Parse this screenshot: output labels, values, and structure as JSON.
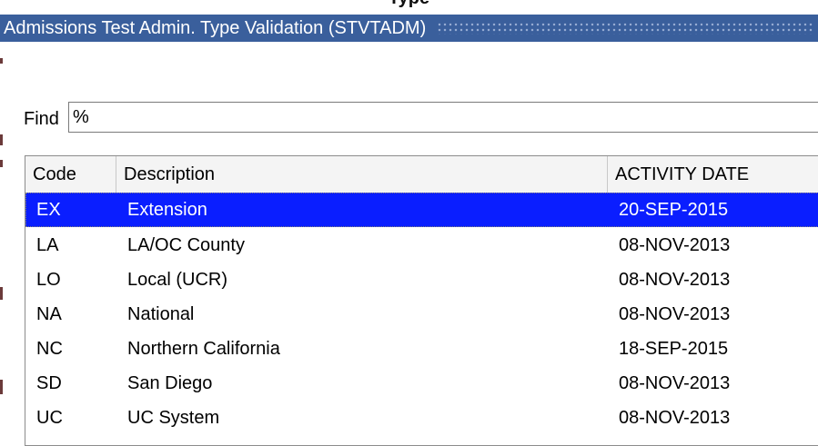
{
  "window": {
    "cut_off_title": "Type",
    "title": "Admissions Test Admin. Type Validation (STVTADM)"
  },
  "find": {
    "label": "Find",
    "value": "%"
  },
  "grid": {
    "headers": {
      "code": "Code",
      "description": "Description",
      "activity_date": "ACTIVITY DATE"
    },
    "rows": [
      {
        "code": "EX",
        "description": "Extension",
        "activity_date": "20-SEP-2015",
        "selected": true
      },
      {
        "code": "LA",
        "description": "LA/OC County",
        "activity_date": "08-NOV-2013"
      },
      {
        "code": "LO",
        "description": "Local (UCR)",
        "activity_date": "08-NOV-2013"
      },
      {
        "code": "NA",
        "description": "National",
        "activity_date": "08-NOV-2013"
      },
      {
        "code": "NC",
        "description": "Northern California",
        "activity_date": "18-SEP-2015"
      },
      {
        "code": "SD",
        "description": "San Diego",
        "activity_date": "08-NOV-2013"
      },
      {
        "code": "UC",
        "description": "UC System",
        "activity_date": "08-NOV-2013"
      }
    ]
  },
  "colors": {
    "titlebar": "#3a5f9c",
    "selected_row": "#0a1eff"
  }
}
